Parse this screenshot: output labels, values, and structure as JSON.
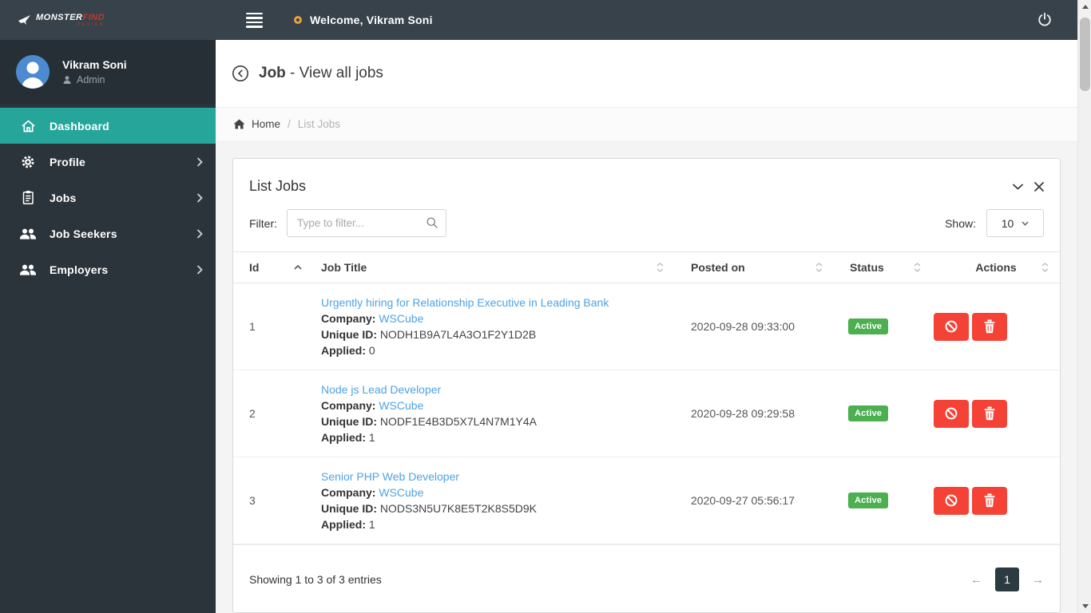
{
  "topbar": {
    "logo": {
      "text": "MONSTER",
      "accent": "FIND",
      "subtext": "DESIGN"
    },
    "welcome_text": "Welcome, Vikram Soni"
  },
  "sidebar": {
    "user": {
      "name": "Vikram Soni",
      "role": "Admin"
    },
    "items": [
      {
        "label": "Dashboard",
        "icon": "home-icon",
        "active": true
      },
      {
        "label": "Profile",
        "icon": "gear-icon",
        "active": false
      },
      {
        "label": "Jobs",
        "icon": "clipboard-icon",
        "active": false
      },
      {
        "label": "Job Seekers",
        "icon": "users-icon",
        "active": false
      },
      {
        "label": "Employers",
        "icon": "users-icon",
        "active": false
      }
    ]
  },
  "page": {
    "title_bold": "Job",
    "title_rest": " - View all jobs",
    "breadcrumb": {
      "home": "Home",
      "separator": "/",
      "current": "List Jobs"
    }
  },
  "card": {
    "title": "List Jobs",
    "filter_label": "Filter:",
    "filter_placeholder": "Type to filter...",
    "show_label": "Show:",
    "show_value": "10",
    "table": {
      "columns": [
        "Id",
        "Job Title",
        "Posted on",
        "Status",
        "Actions"
      ],
      "row_labels": {
        "company": "Company:",
        "unique_id": "Unique ID:",
        "applied": "Applied:"
      },
      "rows": [
        {
          "id": "1",
          "title": "Urgently hiring for Relationship Executive in Leading Bank",
          "company": "WSCube",
          "unique_id": "NODH1B9A7L4A3O1F2Y1D2B",
          "applied": "0",
          "posted_on": "2020-09-28 09:33:00",
          "status": "Active"
        },
        {
          "id": "2",
          "title": "Node js Lead Developer",
          "company": "WSCube",
          "unique_id": "NODF1E4B3D5X7L4N7M1Y4A",
          "applied": "1",
          "posted_on": "2020-09-28 09:29:58",
          "status": "Active"
        },
        {
          "id": "3",
          "title": "Senior PHP Web Developer",
          "company": "WSCube",
          "unique_id": "NODS3N5U7K8E5T2K8S5D9K",
          "applied": "1",
          "posted_on": "2020-09-27 05:56:17",
          "status": "Active"
        }
      ]
    },
    "footer": {
      "summary": "Showing 1 to 3 of 3 entries",
      "prev": "←",
      "page": "1",
      "next": "→"
    }
  },
  "colors": {
    "topbar_bg": "#37424b",
    "sidebar_bg": "#2c343b",
    "active_teal": "#26a69a",
    "link_blue": "#4fa3e3",
    "badge_green": "#4caf50",
    "button_red": "#f44336",
    "pagination_dark": "#2c3a42",
    "welcome_ring_orange": "#e8a33d"
  }
}
